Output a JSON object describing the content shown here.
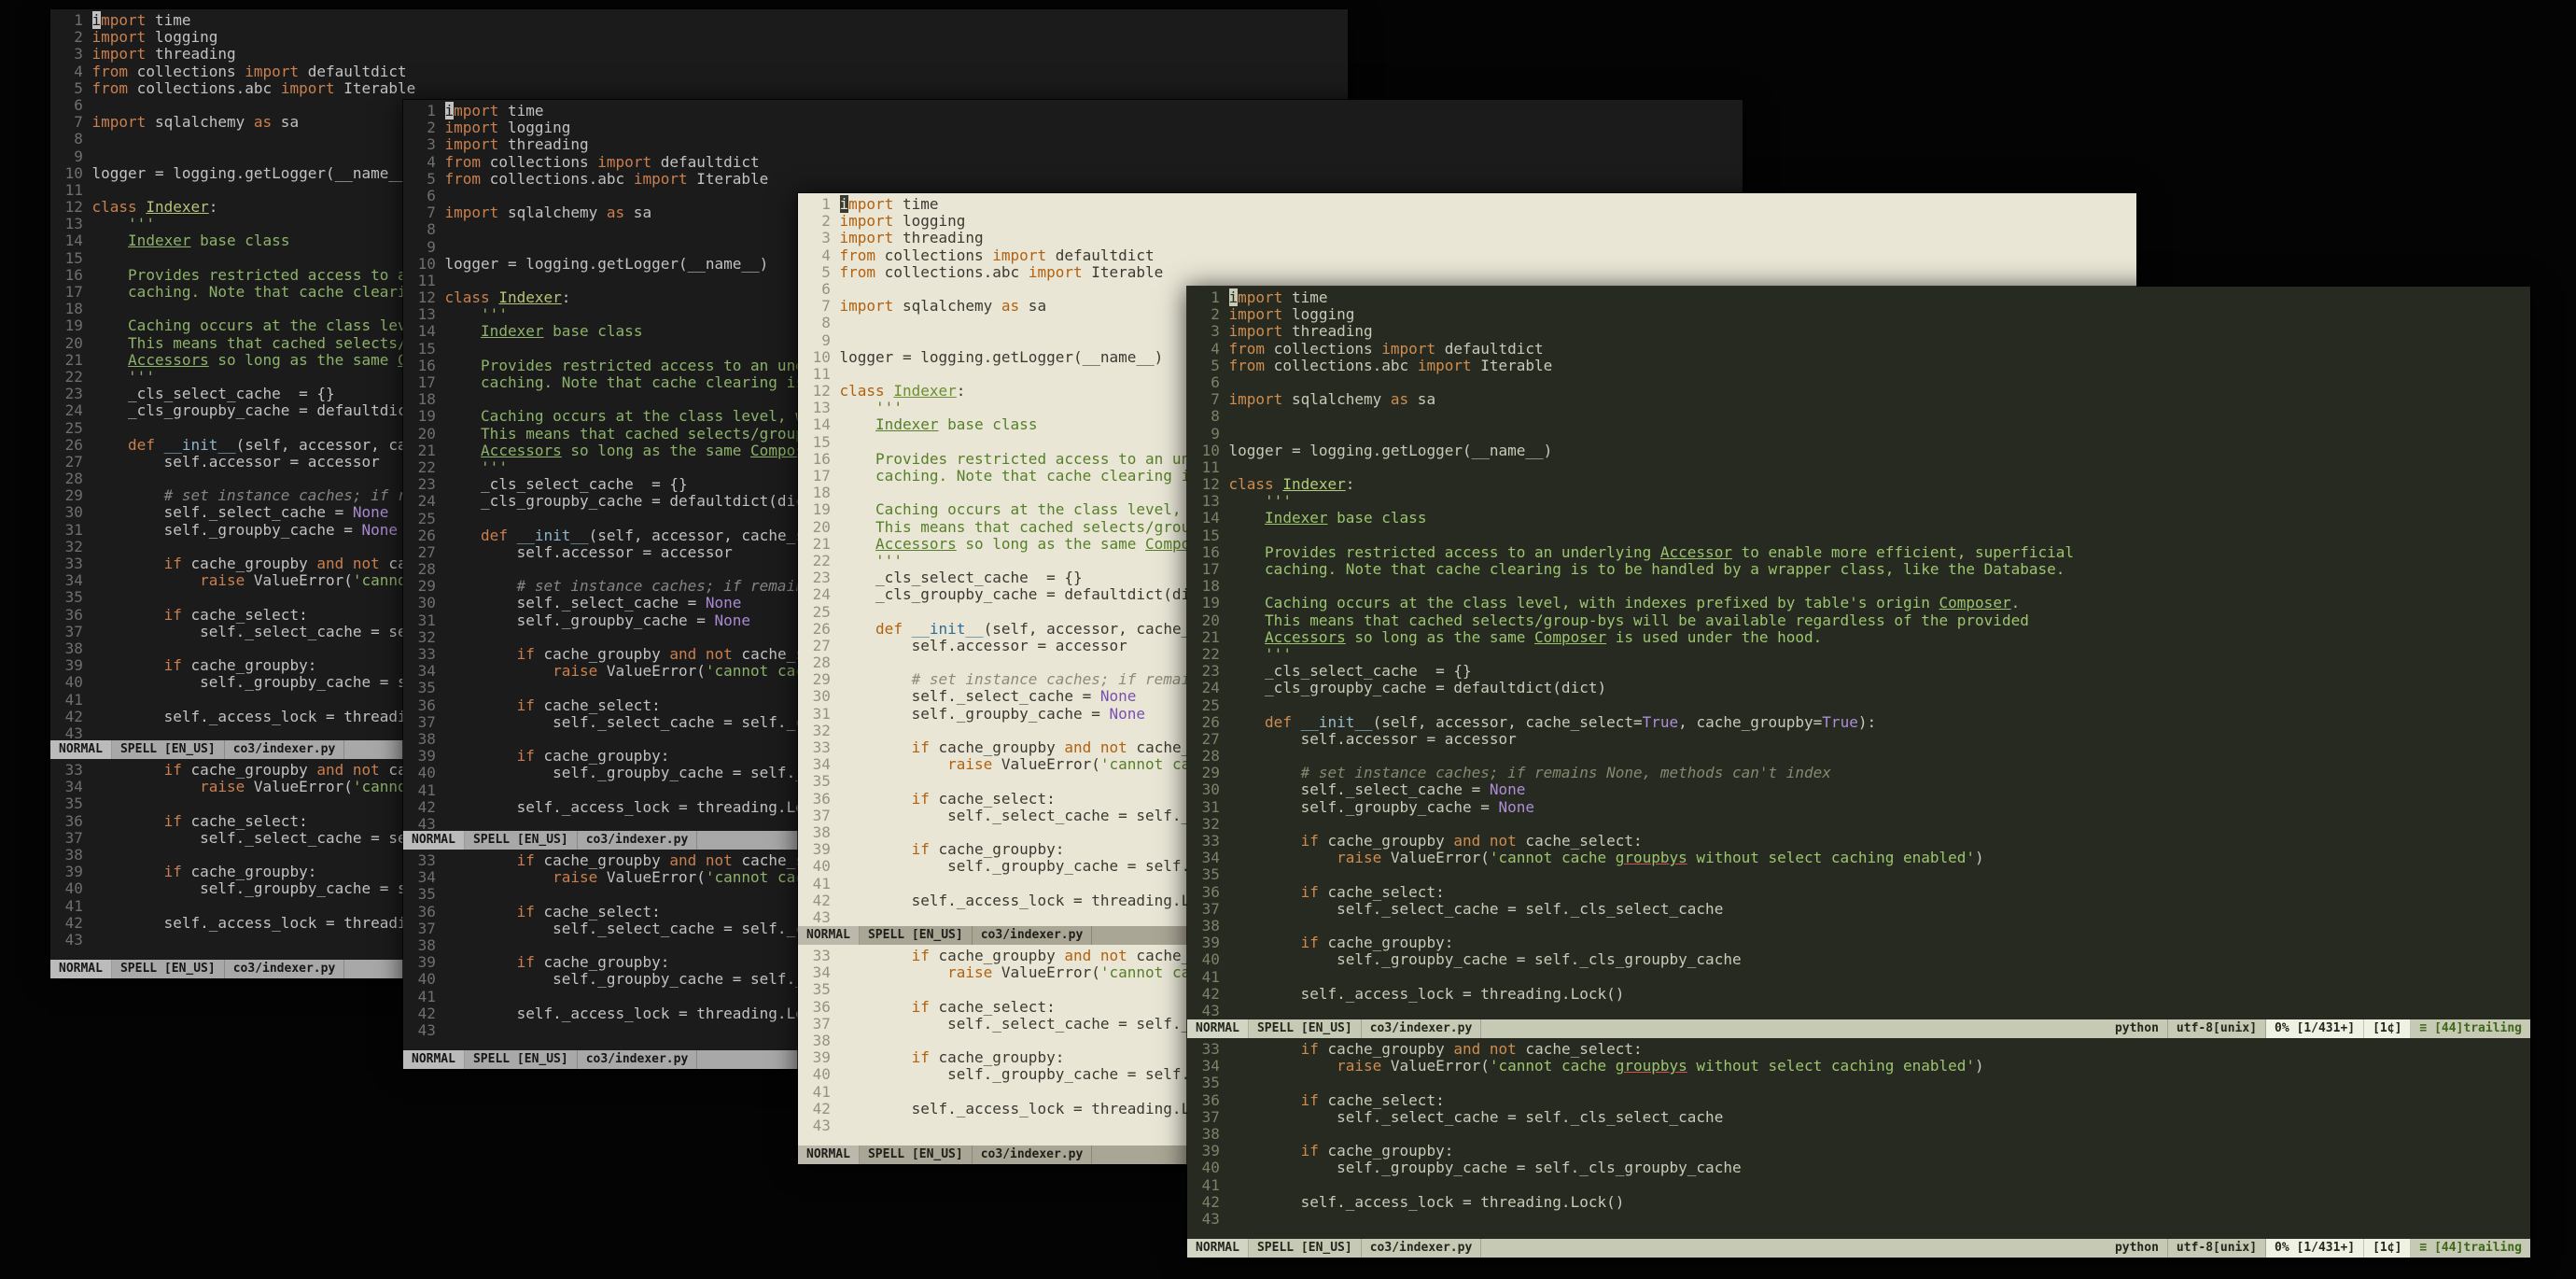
{
  "statusbar": {
    "mode": "NORMAL",
    "spell": "SPELL [EN_US]",
    "file": "co3/indexer.py",
    "filetype": "python",
    "encoding": "utf-8[unix]",
    "position": "0% [1/431+]",
    "buffer": "[1¢]",
    "trailing": "≡ [44]trailing"
  },
  "code": {
    "filename": "co3/indexer.py",
    "language": "python",
    "bottom_split_start_line": 33,
    "lines": [
      {
        "n": 1,
        "t": [
          [
            "cur",
            "i"
          ],
          [
            "kw",
            "mport"
          ],
          [
            "pl",
            " time"
          ]
        ]
      },
      {
        "n": 2,
        "t": [
          [
            "kw",
            "import"
          ],
          [
            "pl",
            " logging"
          ]
        ]
      },
      {
        "n": 3,
        "t": [
          [
            "kw",
            "import"
          ],
          [
            "pl",
            " threading"
          ]
        ]
      },
      {
        "n": 4,
        "t": [
          [
            "kw",
            "from"
          ],
          [
            "pl",
            " collections "
          ],
          [
            "kw",
            "import"
          ],
          [
            "pl",
            " defaultdict"
          ]
        ]
      },
      {
        "n": 5,
        "t": [
          [
            "kw",
            "from"
          ],
          [
            "pl",
            " collections.abc "
          ],
          [
            "kw",
            "import"
          ],
          [
            "pl",
            " Iterable"
          ]
        ]
      },
      {
        "n": 6,
        "t": []
      },
      {
        "n": 7,
        "t": [
          [
            "kw",
            "import"
          ],
          [
            "pl",
            " sqlalchemy "
          ],
          [
            "kw",
            "as"
          ],
          [
            "pl",
            " sa"
          ]
        ]
      },
      {
        "n": 8,
        "t": []
      },
      {
        "n": 9,
        "t": []
      },
      {
        "n": 10,
        "t": [
          [
            "pl",
            "logger = logging.getLogger(__name__)"
          ]
        ]
      },
      {
        "n": 11,
        "t": []
      },
      {
        "n": 12,
        "t": [
          [
            "kw",
            "class"
          ],
          [
            "pl",
            " "
          ],
          [
            "cls",
            "Indexer"
          ],
          [
            "pl",
            ":"
          ]
        ]
      },
      {
        "n": 13,
        "t": [
          [
            "str",
            "    '''"
          ]
        ]
      },
      {
        "n": 14,
        "t": [
          [
            "str",
            "    "
          ],
          [
            "stru",
            "Indexer"
          ],
          [
            "str",
            " base class"
          ]
        ]
      },
      {
        "n": 15,
        "t": []
      },
      {
        "n": 16,
        "t": [
          [
            "str",
            "    Provides restricted access to an underlying "
          ],
          [
            "stru",
            "Accessor"
          ],
          [
            "str",
            " to enable more efficient, superficial"
          ]
        ]
      },
      {
        "n": 17,
        "t": [
          [
            "str",
            "    caching. Note that cache clearing is to be handled by a wrapper class, like the Database."
          ]
        ]
      },
      {
        "n": 18,
        "t": []
      },
      {
        "n": 19,
        "t": [
          [
            "str",
            "    Caching occurs at the class level, with indexes prefixed by table's origin "
          ],
          [
            "stru",
            "Composer"
          ],
          [
            "str",
            "."
          ]
        ]
      },
      {
        "n": 20,
        "t": [
          [
            "str",
            "    This means that cached selects/group-bys will be available regardless of the provided"
          ]
        ]
      },
      {
        "n": 21,
        "t": [
          [
            "str",
            "    "
          ],
          [
            "stru",
            "Accessors"
          ],
          [
            "str",
            " so long as the same "
          ],
          [
            "stru",
            "Composer"
          ],
          [
            "str",
            " is used under the hood."
          ]
        ]
      },
      {
        "n": 22,
        "t": [
          [
            "str",
            "    '''"
          ]
        ]
      },
      {
        "n": 23,
        "t": [
          [
            "pl",
            "    _cls_select_cache  = {}"
          ]
        ]
      },
      {
        "n": 24,
        "t": [
          [
            "pl",
            "    _cls_groupby_cache = defaultdict(dict)"
          ]
        ]
      },
      {
        "n": 25,
        "t": []
      },
      {
        "n": 26,
        "t": [
          [
            "pl",
            "    "
          ],
          [
            "kw",
            "def"
          ],
          [
            "pl",
            " "
          ],
          [
            "fn",
            "__init__"
          ],
          [
            "pl",
            "(self, accessor, cache_select="
          ],
          [
            "bi",
            "True"
          ],
          [
            "pl",
            ", cache_groupby="
          ],
          [
            "bi",
            "True"
          ],
          [
            "pl",
            "):"
          ]
        ]
      },
      {
        "n": 27,
        "t": [
          [
            "pl",
            "        self.accessor = accessor"
          ]
        ]
      },
      {
        "n": 28,
        "t": []
      },
      {
        "n": 29,
        "t": [
          [
            "com",
            "        # set instance caches; if remains None, methods can't index"
          ]
        ]
      },
      {
        "n": 30,
        "t": [
          [
            "pl",
            "        self._select_cache = "
          ],
          [
            "bi",
            "None"
          ]
        ]
      },
      {
        "n": 31,
        "t": [
          [
            "pl",
            "        self._groupby_cache = "
          ],
          [
            "bi",
            "None"
          ]
        ]
      },
      {
        "n": 32,
        "t": []
      },
      {
        "n": 33,
        "t": [
          [
            "pl",
            "        "
          ],
          [
            "kw",
            "if"
          ],
          [
            "pl",
            " cache_groupby "
          ],
          [
            "kw",
            "and"
          ],
          [
            "pl",
            " "
          ],
          [
            "kw",
            "not"
          ],
          [
            "pl",
            " cache_select:"
          ]
        ]
      },
      {
        "n": 34,
        "t": [
          [
            "pl",
            "            "
          ],
          [
            "kw",
            "raise"
          ],
          [
            "pl",
            " ValueError("
          ],
          [
            "str",
            "'cannot cache "
          ],
          [
            "strerr",
            "groupbys"
          ],
          [
            "str",
            " without select caching enabled'"
          ],
          [
            "pl",
            ")"
          ]
        ]
      },
      {
        "n": 35,
        "t": []
      },
      {
        "n": 36,
        "t": [
          [
            "pl",
            "        "
          ],
          [
            "kw",
            "if"
          ],
          [
            "pl",
            " cache_select:"
          ]
        ]
      },
      {
        "n": 37,
        "t": [
          [
            "pl",
            "            self._select_cache = self._cls_select_cache"
          ]
        ]
      },
      {
        "n": 38,
        "t": []
      },
      {
        "n": 39,
        "t": [
          [
            "pl",
            "        "
          ],
          [
            "kw",
            "if"
          ],
          [
            "pl",
            " cache_groupby:"
          ]
        ]
      },
      {
        "n": 40,
        "t": [
          [
            "pl",
            "            self._groupby_cache = self._cls_groupby_cache"
          ]
        ]
      },
      {
        "n": 41,
        "t": []
      },
      {
        "n": 42,
        "t": [
          [
            "pl",
            "        self._access_lock = threading.Lock()"
          ]
        ]
      },
      {
        "n": 43,
        "t": []
      }
    ]
  }
}
